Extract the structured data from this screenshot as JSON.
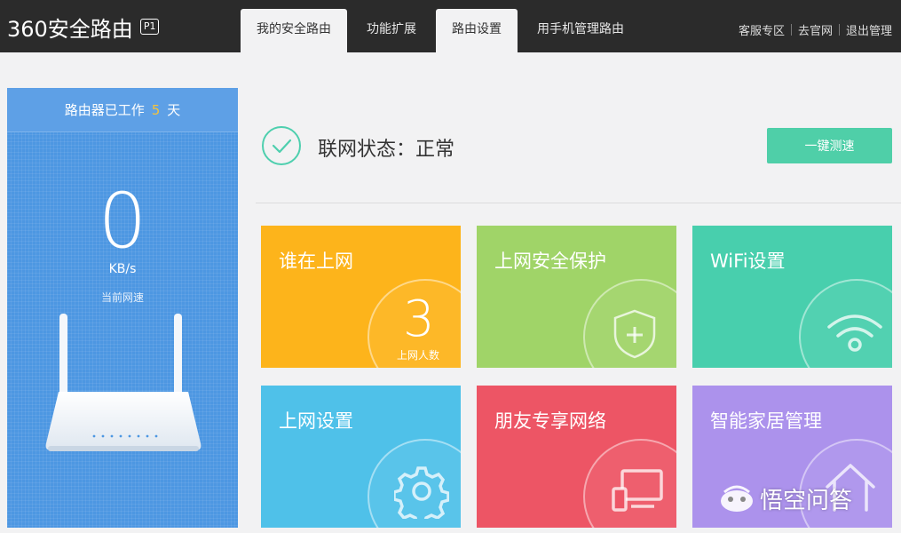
{
  "app": {
    "logo_text": "360安全路由",
    "model_badge": "P1"
  },
  "tabs": [
    {
      "label": "我的安全路由",
      "active": true
    },
    {
      "label": "功能扩展",
      "active": false
    },
    {
      "label": "路由设置",
      "active": true
    },
    {
      "label": "用手机管理路由",
      "active": false
    }
  ],
  "top_links": [
    "客服专区",
    "去官网",
    "退出管理"
  ],
  "uptime": {
    "prefix": "路由器已工作",
    "days": "5",
    "suffix": "天"
  },
  "speed": {
    "value": "0",
    "unit": "KB/s",
    "caption": "当前网速"
  },
  "status": {
    "text": "联网状态：正常",
    "button_label": "一键测速"
  },
  "tiles": [
    {
      "title": "谁在上网",
      "color": "#fdb41b",
      "count": "3",
      "count_caption": "上网人数"
    },
    {
      "title": "上网安全保护",
      "color": "#a0d468",
      "icon": "shield-plus-icon"
    },
    {
      "title": "WiFi设置",
      "color": "#48cfad",
      "icon": "wifi-icon"
    },
    {
      "title": "上网设置",
      "color": "#4fc1e9",
      "icon": "gear-icon"
    },
    {
      "title": "朋友专享网络",
      "color": "#ed5565",
      "icon": "devices-icon"
    },
    {
      "title": "智能家居管理",
      "color": "#ac92ec",
      "icon": "home-icon"
    }
  ],
  "watermark": "悟空问答",
  "colors": {
    "topbar": "#2b2b2b",
    "left_panel": "#4d97e2",
    "accent_green": "#4fcfa8",
    "uptime_days": "#f5c33b"
  }
}
